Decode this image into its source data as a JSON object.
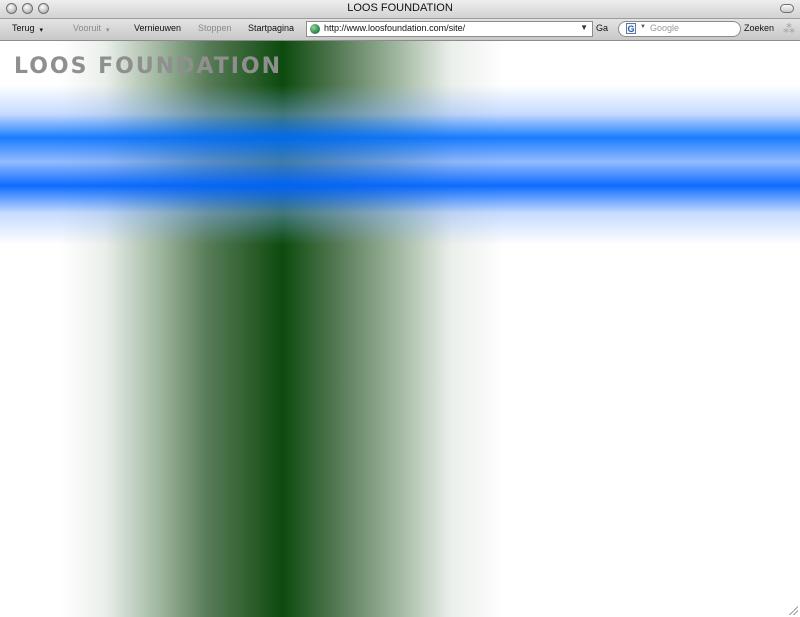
{
  "window": {
    "title": "LOOS FOUNDATION"
  },
  "toolbar": {
    "back_label": "Terug",
    "forward_label": "Vooruit",
    "reload_label": "Vernieuwen",
    "stop_label": "Stoppen",
    "home_label": "Startpagina",
    "address_value": "http://www.loosfoundation.com/site/",
    "go_label": "Ga",
    "search_placeholder": "Google",
    "search_button_label": "Zoeken"
  },
  "page": {
    "logo_text": "LOOS FOUNDATION"
  },
  "colors": {
    "green_band": "#0d4a0d",
    "blue_band": "#006eff",
    "logo": "#8f8f8f"
  },
  "icons": [
    "close-light-icon",
    "minimize-light-icon",
    "zoom-light-icon",
    "globe-icon",
    "google-icon",
    "spinner-icon",
    "resize-grip-icon"
  ]
}
